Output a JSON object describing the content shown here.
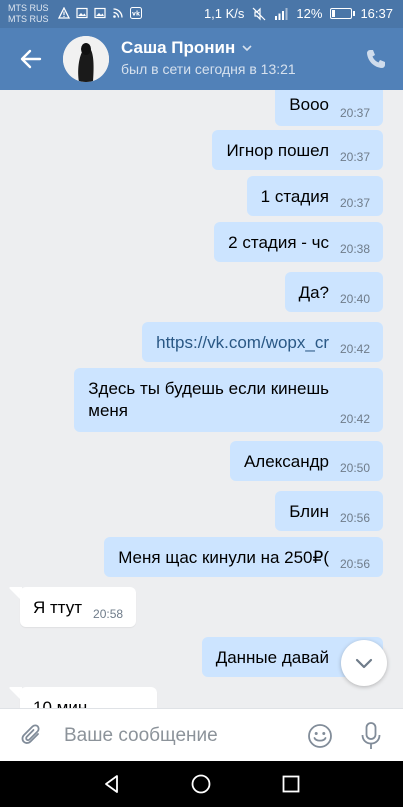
{
  "status_bar": {
    "carrier_1": "MTS RUS",
    "carrier_2": "MTS RUS",
    "speed": "1,1 K/s",
    "battery": "12%",
    "time": "16:37"
  },
  "header": {
    "contact_name": "Саша Пронин",
    "last_seen": "был в сети сегодня в 13:21"
  },
  "messages": [
    {
      "dir": "out",
      "text": "Вooo",
      "time": "20:37"
    },
    {
      "dir": "out",
      "text": "Игнор пошел",
      "time": "20:37"
    },
    {
      "dir": "out",
      "text": "1 стадия",
      "time": "20:37"
    },
    {
      "dir": "out",
      "text": "2 стадия - чс",
      "time": "20:38"
    },
    {
      "dir": "out",
      "text": "Да?",
      "time": "20:40"
    },
    {
      "dir": "out",
      "text": "https://vk.com/wopx_cr",
      "time": "20:42",
      "link": true
    },
    {
      "dir": "out",
      "text": "Здесь ты будешь если кинешь\nменя",
      "time": "20:42"
    },
    {
      "dir": "out",
      "text": "Александр",
      "time": "20:50"
    },
    {
      "dir": "out",
      "text": "Блин",
      "time": "20:56"
    },
    {
      "dir": "out",
      "text": "Меня щас кинули на 250₽(",
      "time": "20:56"
    },
    {
      "dir": "in",
      "text": "Я ттут",
      "time": "20:58"
    },
    {
      "dir": "out",
      "text": "Данные давай",
      "time": ""
    },
    {
      "dir": "in",
      "text": "10 мин",
      "time": ""
    }
  ],
  "composer": {
    "placeholder": "Ваше сообщение"
  },
  "icons": {
    "back": "arrow-left-icon",
    "phone": "phone-icon",
    "attach": "paperclip-icon",
    "emoji": "smiley-icon",
    "mic": "microphone-icon",
    "scroll_down": "chevron-down-icon"
  },
  "colors": {
    "header": "#5181b8",
    "status_bar": "#4a76a8",
    "outgoing_bubble": "#cce4ff",
    "incoming_bubble": "#ffffff",
    "background": "#edeef0"
  }
}
